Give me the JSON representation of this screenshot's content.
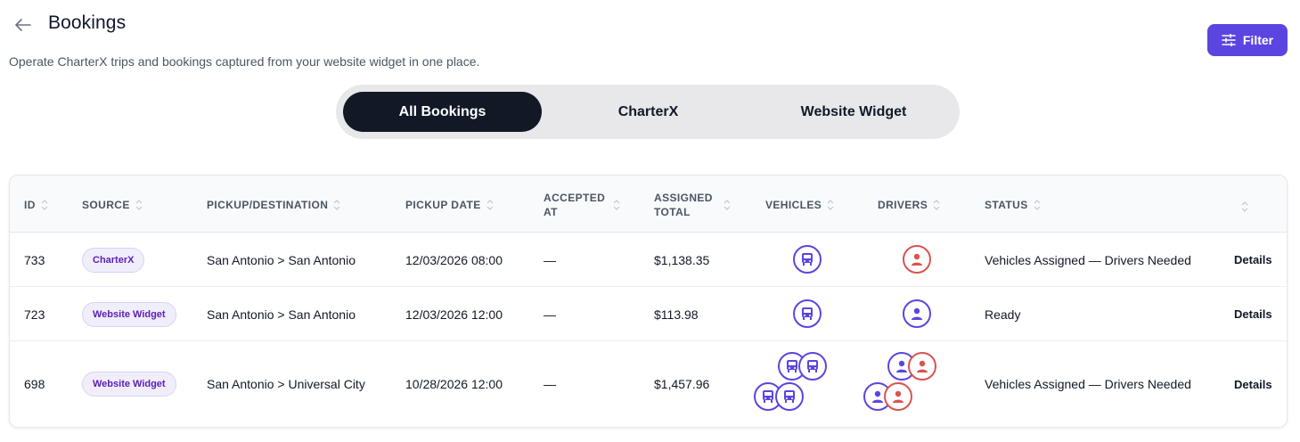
{
  "header": {
    "title": "Bookings",
    "subtitle": "Operate CharterX trips and bookings captured from your website widget in one place.",
    "filter_label": "Filter"
  },
  "tabs": [
    {
      "label": "All Bookings",
      "active": true
    },
    {
      "label": "CharterX",
      "active": false
    },
    {
      "label": "Website Widget",
      "active": false
    }
  ],
  "table": {
    "columns": [
      "ID",
      "SOURCE",
      "PICKUP/DESTINATION",
      "PICKUP DATE",
      "ACCEPTED AT",
      "ASSIGNED TOTAL",
      "VEHICLES",
      "DRIVERS",
      "STATUS"
    ],
    "rows": [
      {
        "id": "733",
        "source": "CharterX",
        "route": "San Antonio > San Antonio",
        "pickup_date": "12/03/2026 08:00",
        "accepted_at": "—",
        "total": "$1,138.35",
        "vehicles": 1,
        "drivers": [
          "unassigned"
        ],
        "status": "Vehicles Assigned — Drivers Needed",
        "action": "Details"
      },
      {
        "id": "723",
        "source": "Website Widget",
        "route": "San Antonio > San Antonio",
        "pickup_date": "12/03/2026 12:00",
        "accepted_at": "—",
        "total": "$113.98",
        "vehicles": 1,
        "drivers": [
          "assigned"
        ],
        "status": "Ready",
        "action": "Details"
      },
      {
        "id": "698",
        "source": "Website Widget",
        "route": "San Antonio > Universal City",
        "pickup_date": "10/28/2026 12:00",
        "accepted_at": "—",
        "total": "$1,457.96",
        "vehicles": 4,
        "drivers": [
          "assigned",
          "unassigned",
          "assigned",
          "unassigned"
        ],
        "status": "Vehicles Assigned — Drivers Needed",
        "action": "Details"
      }
    ]
  },
  "colors": {
    "accent": "#5b45e0",
    "tab_active_bg": "#121826",
    "driver_needed": "#d9534f"
  },
  "icons": {
    "back": "arrow-left-icon",
    "filter": "sliders-icon",
    "sort": "sort-icon",
    "vehicle": "bus-icon",
    "driver": "user-icon"
  }
}
